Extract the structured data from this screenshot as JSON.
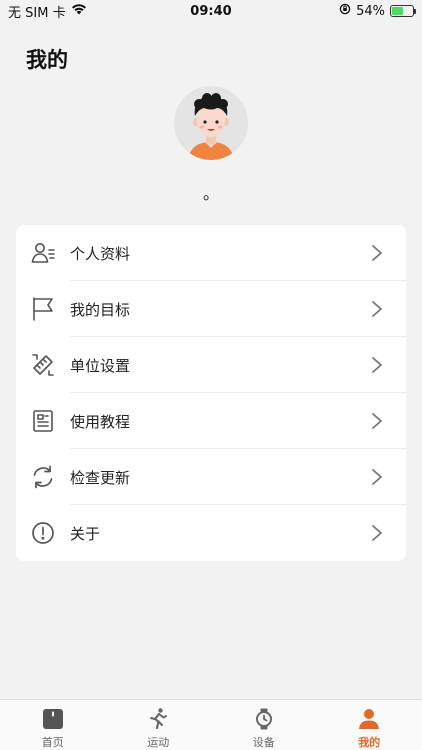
{
  "status_bar": {
    "carrier": "无 SIM 卡",
    "time": "09:40",
    "battery_percent": "54%",
    "battery_level": 0.54
  },
  "header": {
    "title": "我的",
    "nickname": "。"
  },
  "menu": {
    "items": [
      {
        "label": "个人资料",
        "icon": "profile-icon"
      },
      {
        "label": "我的目标",
        "icon": "flag-icon"
      },
      {
        "label": "单位设置",
        "icon": "ruler-pencil-icon"
      },
      {
        "label": "使用教程",
        "icon": "document-icon"
      },
      {
        "label": "检查更新",
        "icon": "refresh-icon"
      },
      {
        "label": "关于",
        "icon": "info-icon"
      }
    ]
  },
  "tab_bar": {
    "tabs": [
      {
        "label": "首页",
        "icon": "home-icon",
        "active": false
      },
      {
        "label": "运动",
        "icon": "run-icon",
        "active": false
      },
      {
        "label": "设备",
        "icon": "watch-icon",
        "active": false
      },
      {
        "label": "我的",
        "icon": "person-icon",
        "active": true
      }
    ]
  },
  "colors": {
    "accent": "#e06a2c",
    "background": "#f2f2f2",
    "card": "#ffffff",
    "icon_gray": "#555555"
  }
}
